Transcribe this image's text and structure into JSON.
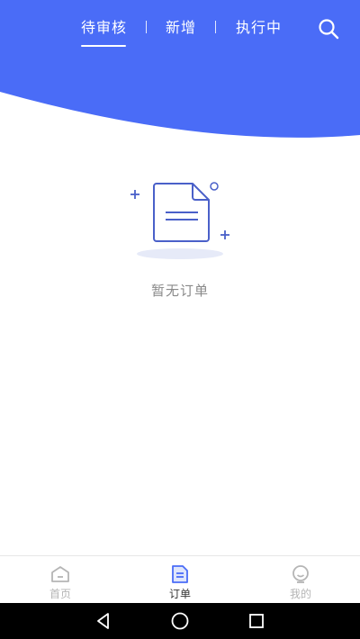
{
  "colors": {
    "brand": "#4a6cf7",
    "accent_icon": "#4a60c9",
    "inactive": "#b5b5b5"
  },
  "header": {
    "tabs": [
      {
        "label": "待审核",
        "active": true
      },
      {
        "label": "新增",
        "active": false
      },
      {
        "label": "执行中",
        "active": false
      }
    ],
    "separator": "|",
    "search_icon": "search-icon"
  },
  "empty_state": {
    "text": "暂无订单",
    "icon": "empty-document-icon"
  },
  "tabbar": {
    "items": [
      {
        "label": "首页",
        "icon": "home-icon",
        "active": false
      },
      {
        "label": "订单",
        "icon": "order-icon",
        "active": true
      },
      {
        "label": "我的",
        "icon": "profile-icon",
        "active": false
      }
    ]
  },
  "system_nav": {
    "buttons": [
      "back-icon",
      "home-circle-icon",
      "recents-icon"
    ]
  }
}
